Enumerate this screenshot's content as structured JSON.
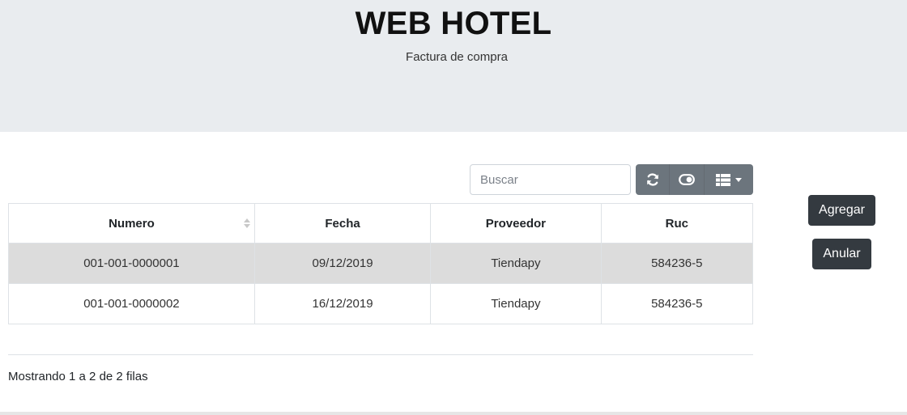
{
  "header": {
    "title": "WEB HOTEL",
    "subtitle": "Factura de compra"
  },
  "toolbar": {
    "search_placeholder": "Buscar",
    "search_value": "",
    "refresh_icon": "refresh-icon",
    "toggle_icon": "toggle-view-icon",
    "columns_icon": "columns-list-icon"
  },
  "table": {
    "columns": [
      "Numero",
      "Fecha",
      "Proveedor",
      "Ruc"
    ],
    "rows": [
      [
        "001-001-0000001",
        "09/12/2019",
        "Tiendapy",
        "584236-5"
      ],
      [
        "001-001-0000002",
        "16/12/2019",
        "Tiendapy",
        "584236-5"
      ]
    ],
    "selected_row": 0
  },
  "pagination": {
    "info": "Mostrando 1 a 2 de 2 filas"
  },
  "actions": {
    "add_label": "Agregar",
    "cancel_label": "Anular"
  },
  "colors": {
    "header_bg": "#e9ecef",
    "toolbar_bg": "#6c757d",
    "dark_button": "#343a40",
    "selected_row_bg": "#dcdcdc"
  }
}
